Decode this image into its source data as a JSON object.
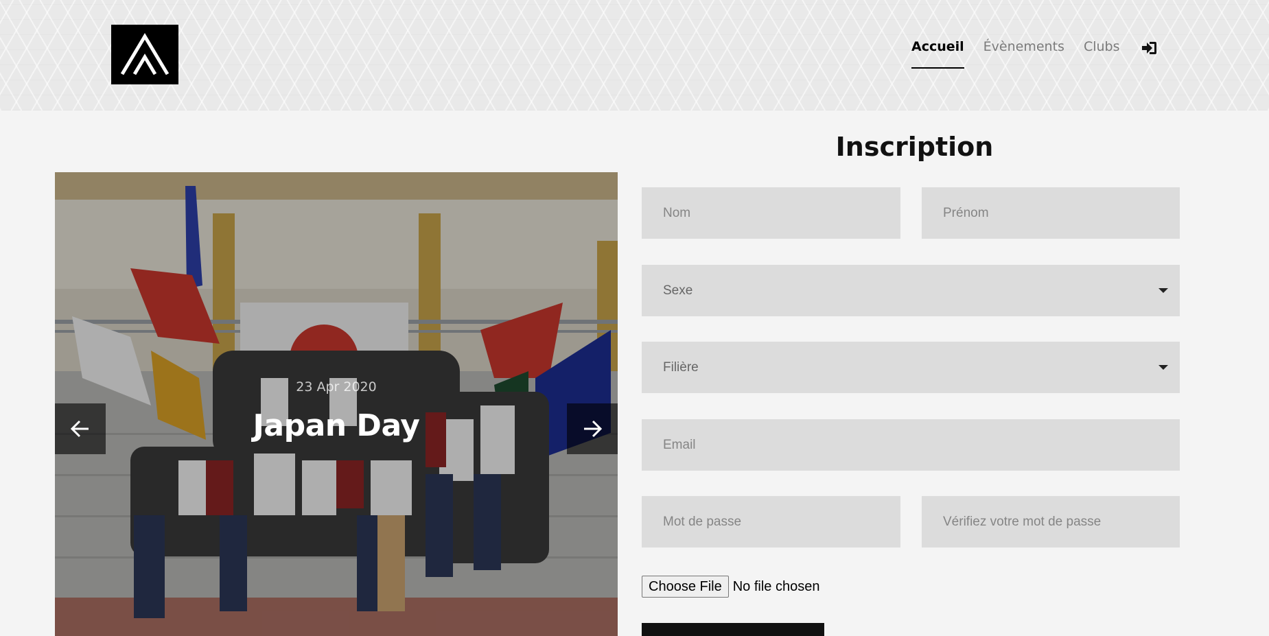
{
  "nav": {
    "items": [
      {
        "label": "Accueil",
        "active": true
      },
      {
        "label": "Évènements",
        "active": false
      },
      {
        "label": "Clubs",
        "active": false
      }
    ],
    "login_icon": "sign-in-icon"
  },
  "carousel": {
    "date": "23 Apr 2020",
    "title": "Japan Day",
    "prev_icon": "arrow-left-icon",
    "next_icon": "arrow-right-icon"
  },
  "form": {
    "title": "Inscription",
    "fields": {
      "nom": "Nom",
      "prenom": "Prénom",
      "sexe": "Sexe",
      "filiere": "Filière",
      "email": "Email",
      "password": "Mot de passe",
      "password_confirm": "Vérifiez votre mot de passe"
    },
    "file": {
      "button": "Choose File",
      "status": "No file chosen"
    }
  },
  "colors": {
    "background": "#f4f4f4",
    "field": "#dcdcdc",
    "accent": "#000000"
  }
}
